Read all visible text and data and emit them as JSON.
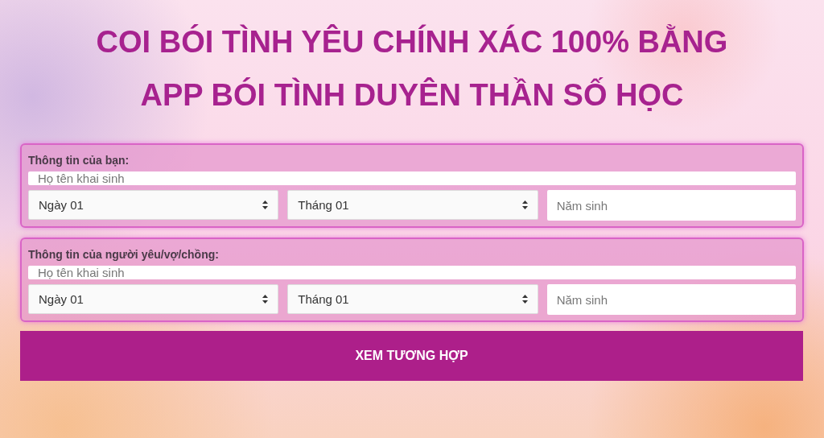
{
  "title_lines": [
    "COI BÓI TÌNH YÊU CHÍNH XÁC 100% BẰNG",
    "APP BÓI TÌNH DUYÊN THẦN SỐ HỌC"
  ],
  "sections": [
    {
      "label": "Thông tin của bạn:",
      "name_field": {
        "placeholder": "Họ tên khai sinh"
      },
      "day_select": {
        "value": "Ngày 01"
      },
      "month_select": {
        "value": "Tháng 01"
      },
      "year_field": {
        "placeholder": "Năm sinh"
      }
    },
    {
      "label": "Thông tin của người yêu/vợ/chồng:",
      "name_field": {
        "placeholder": "Họ tên khai sinh"
      },
      "day_select": {
        "value": "Ngày 01"
      },
      "month_select": {
        "value": "Tháng 01"
      },
      "year_field": {
        "placeholder": "Năm sinh"
      }
    }
  ],
  "submit_button": {
    "label": "XEM TƯƠNG HỢP"
  }
}
